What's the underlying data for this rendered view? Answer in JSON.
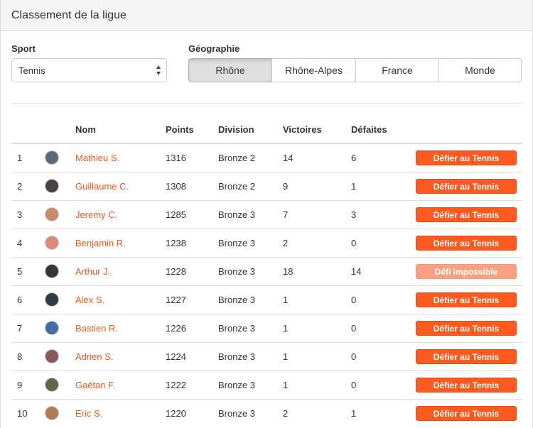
{
  "panel": {
    "title": "Classement de la ligue"
  },
  "filters": {
    "sport_label": "Sport",
    "sport_value": "Tennis",
    "geo_label": "Géographie",
    "geo_options": [
      "Rhône",
      "Rhône-Alpes",
      "France",
      "Monde"
    ],
    "geo_active": "Rhône"
  },
  "table": {
    "headers": {
      "rank": "",
      "avatar": "",
      "name": "Nom",
      "points": "Points",
      "division": "Division",
      "wins": "Victoires",
      "losses": "Défaites",
      "action": ""
    },
    "rows": [
      {
        "rank": "1",
        "name": "Mathieu S.",
        "points": "1316",
        "division": "Bronze 2",
        "wins": "14",
        "losses": "6",
        "action": "Défier au Tennis",
        "action_enabled": true,
        "avatar_color": "#5a6b7a"
      },
      {
        "rank": "2",
        "name": "Guillaume C.",
        "points": "1308",
        "division": "Bronze 2",
        "wins": "9",
        "losses": "1",
        "action": "Défier au Tennis",
        "action_enabled": true,
        "avatar_color": "#4a4440"
      },
      {
        "rank": "3",
        "name": "Jeremy C.",
        "points": "1285",
        "division": "Bronze 3",
        "wins": "7",
        "losses": "3",
        "action": "Défier au Tennis",
        "action_enabled": true,
        "avatar_color": "#c98a6a"
      },
      {
        "rank": "4",
        "name": "Benjamin R.",
        "points": "1238",
        "division": "Bronze 3",
        "wins": "2",
        "losses": "0",
        "action": "Défier au Tennis",
        "action_enabled": true,
        "avatar_color": "#d98a7a"
      },
      {
        "rank": "5",
        "name": "Arthur J.",
        "points": "1228",
        "division": "Bronze 3",
        "wins": "18",
        "losses": "14",
        "action": "Défi impossible",
        "action_enabled": false,
        "avatar_color": "#3a3530"
      },
      {
        "rank": "6",
        "name": "Alex S.",
        "points": "1227",
        "division": "Bronze 3",
        "wins": "1",
        "losses": "0",
        "action": "Défier au Tennis",
        "action_enabled": true,
        "avatar_color": "#2f3a45"
      },
      {
        "rank": "7",
        "name": "Bastien R.",
        "points": "1226",
        "division": "Bronze 3",
        "wins": "1",
        "losses": "0",
        "action": "Défier au Tennis",
        "action_enabled": true,
        "avatar_color": "#3f6fa0"
      },
      {
        "rank": "8",
        "name": "Adrien S.",
        "points": "1224",
        "division": "Bronze 3",
        "wins": "1",
        "losses": "0",
        "action": "Défier au Tennis",
        "action_enabled": true,
        "avatar_color": "#8a5a5a"
      },
      {
        "rank": "9",
        "name": "Gaëtan F.",
        "points": "1222",
        "division": "Bronze 3",
        "wins": "1",
        "losses": "0",
        "action": "Défier au Tennis",
        "action_enabled": true,
        "avatar_color": "#5a6a4a"
      },
      {
        "rank": "10",
        "name": "Eric S.",
        "points": "1220",
        "division": "Bronze 3",
        "wins": "2",
        "losses": "1",
        "action": "Défier au Tennis",
        "action_enabled": true,
        "avatar_color": "#b07a5a"
      }
    ]
  },
  "colors": {
    "accent": "#f45721",
    "button": "#ff5a1f",
    "button_disabled": "#f8a07f"
  }
}
